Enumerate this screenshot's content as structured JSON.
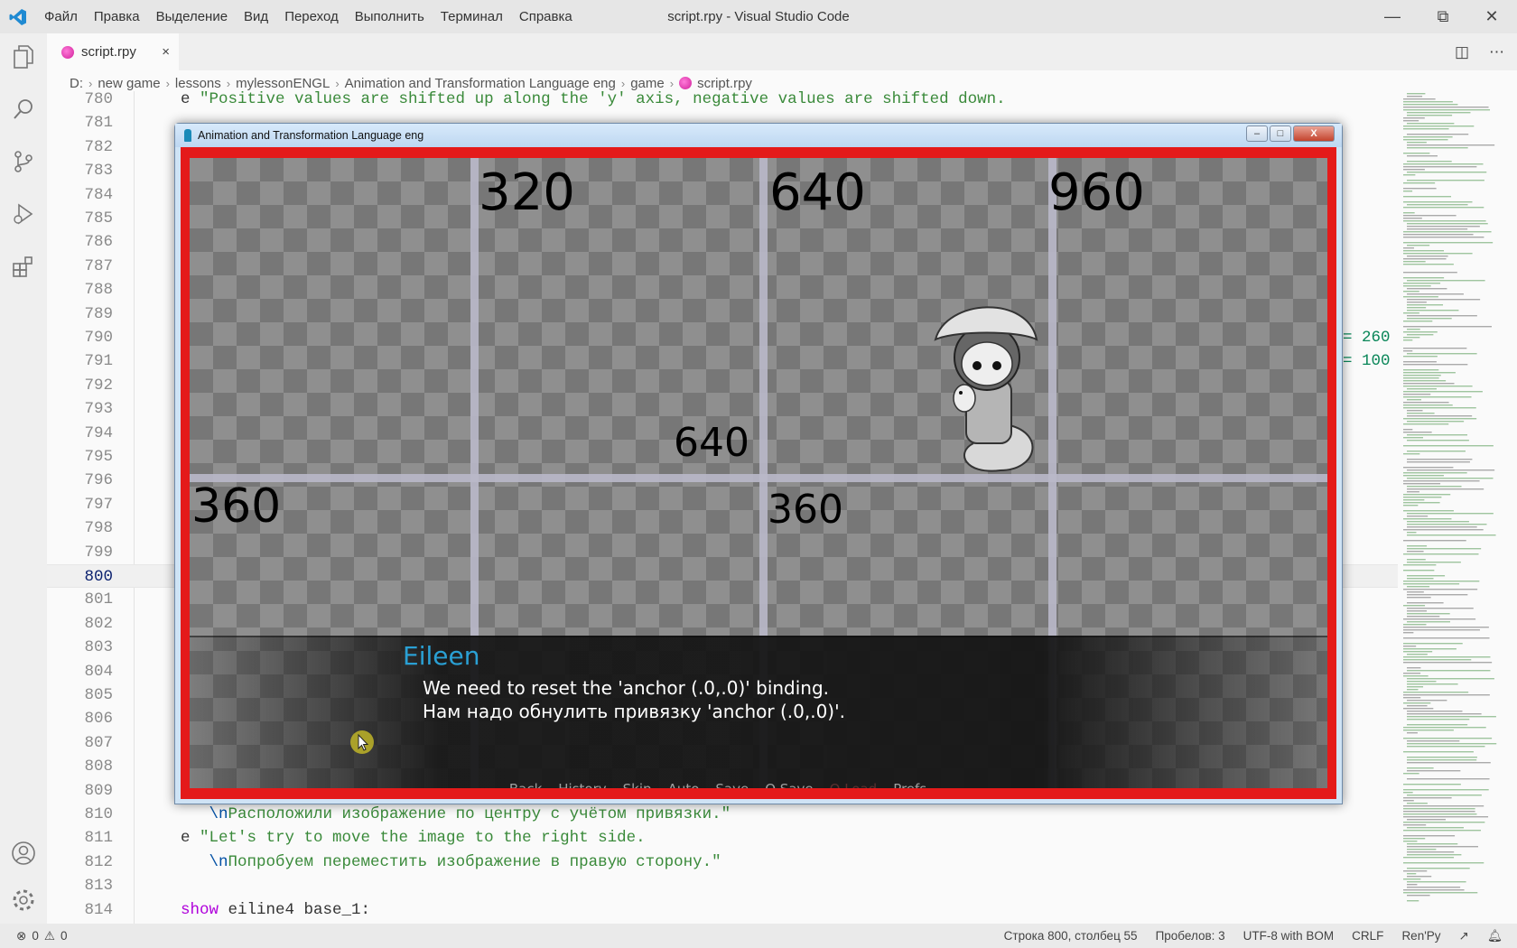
{
  "titlebar": {
    "menu": [
      "Файл",
      "Правка",
      "Выделение",
      "Вид",
      "Переход",
      "Выполнить",
      "Терминал",
      "Справка"
    ],
    "title": "script.rpy - Visual Studio Code"
  },
  "tab": {
    "label": "script.rpy",
    "close": "×"
  },
  "breadcrumb": [
    "D:",
    "new game",
    "lessons",
    "mylessonENGL",
    "Animation and Transformation Language eng",
    "game",
    "script.rpy"
  ],
  "editor": {
    "current_line": 800,
    "lines": [
      {
        "n": 780,
        "tokens": [
          {
            "c": "id",
            "t": "e "
          },
          {
            "c": "str",
            "t": "\"Positive values are shifted up along the 'y' axis, negative values are shifted down."
          }
        ]
      },
      {
        "n": 781,
        "tokens": []
      },
      {
        "n": 782,
        "tokens": []
      },
      {
        "n": 783,
        "tokens": []
      },
      {
        "n": 784,
        "tokens": []
      },
      {
        "n": 785,
        "tokens": []
      },
      {
        "n": 786,
        "tokens": []
      },
      {
        "n": 787,
        "tokens": []
      },
      {
        "n": 788,
        "tokens": []
      },
      {
        "n": 789,
        "tokens": []
      },
      {
        "n": 790,
        "tokens": [],
        "far": "= 260"
      },
      {
        "n": 791,
        "tokens": [],
        "far": "= 100"
      },
      {
        "n": 792,
        "tokens": []
      },
      {
        "n": 793,
        "tokens": []
      },
      {
        "n": 794,
        "tokens": []
      },
      {
        "n": 795,
        "tokens": []
      },
      {
        "n": 796,
        "tokens": []
      },
      {
        "n": 797,
        "tokens": []
      },
      {
        "n": 798,
        "tokens": []
      },
      {
        "n": 799,
        "tokens": []
      },
      {
        "n": 800,
        "tokens": []
      },
      {
        "n": 801,
        "tokens": []
      },
      {
        "n": 802,
        "tokens": []
      },
      {
        "n": 803,
        "tokens": []
      },
      {
        "n": 804,
        "tokens": []
      },
      {
        "n": 805,
        "tokens": []
      },
      {
        "n": 806,
        "tokens": []
      },
      {
        "n": 807,
        "tokens": []
      },
      {
        "n": 808,
        "tokens": []
      },
      {
        "n": 809,
        "tokens": []
      },
      {
        "n": 810,
        "tokens": [
          {
            "c": "id",
            "t": "   "
          },
          {
            "c": "esc",
            "t": "\\n"
          },
          {
            "c": "str",
            "t": "Расположили изображение по центру с учётом привязки.\""
          }
        ]
      },
      {
        "n": 811,
        "tokens": [
          {
            "c": "id",
            "t": "e "
          },
          {
            "c": "str",
            "t": "\"Let's try to move the image to the right side."
          }
        ]
      },
      {
        "n": 812,
        "tokens": [
          {
            "c": "id",
            "t": "   "
          },
          {
            "c": "esc",
            "t": "\\n"
          },
          {
            "c": "str",
            "t": "Попробуем переместить изображение в правую сторону.\""
          }
        ]
      },
      {
        "n": 813,
        "tokens": []
      },
      {
        "n": 814,
        "tokens": [
          {
            "c": "kw",
            "t": "show"
          },
          {
            "c": "id",
            "t": " eiline4 base_1:"
          }
        ]
      }
    ]
  },
  "statusbar": {
    "errors": "0",
    "warnings": "0",
    "position": "Строка 800, столбец 55",
    "spaces": "Пробелов: 3",
    "encoding": "UTF-8 with BOM",
    "eol": "CRLF",
    "language": "Ren'Py"
  },
  "game_window": {
    "title": "Animation and Transformation Language eng",
    "border_color": "#e41a1a",
    "labels": {
      "x320": "320",
      "x640": "640",
      "x960": "960",
      "center_x": "640",
      "left_y": "360",
      "center_y": "360"
    },
    "dialog": {
      "speaker": "Eileen",
      "speaker_color": "#2aa0d4",
      "line1": "We need to reset the 'anchor (.0,.0)' binding.",
      "line2": "Нам надо обнулить привязку 'anchor (.0,.0)'."
    },
    "quick_menu": [
      "Back",
      "History",
      "Skip",
      "Auto",
      "Save",
      "Q.Save",
      "Q.Load",
      "Prefs"
    ]
  }
}
